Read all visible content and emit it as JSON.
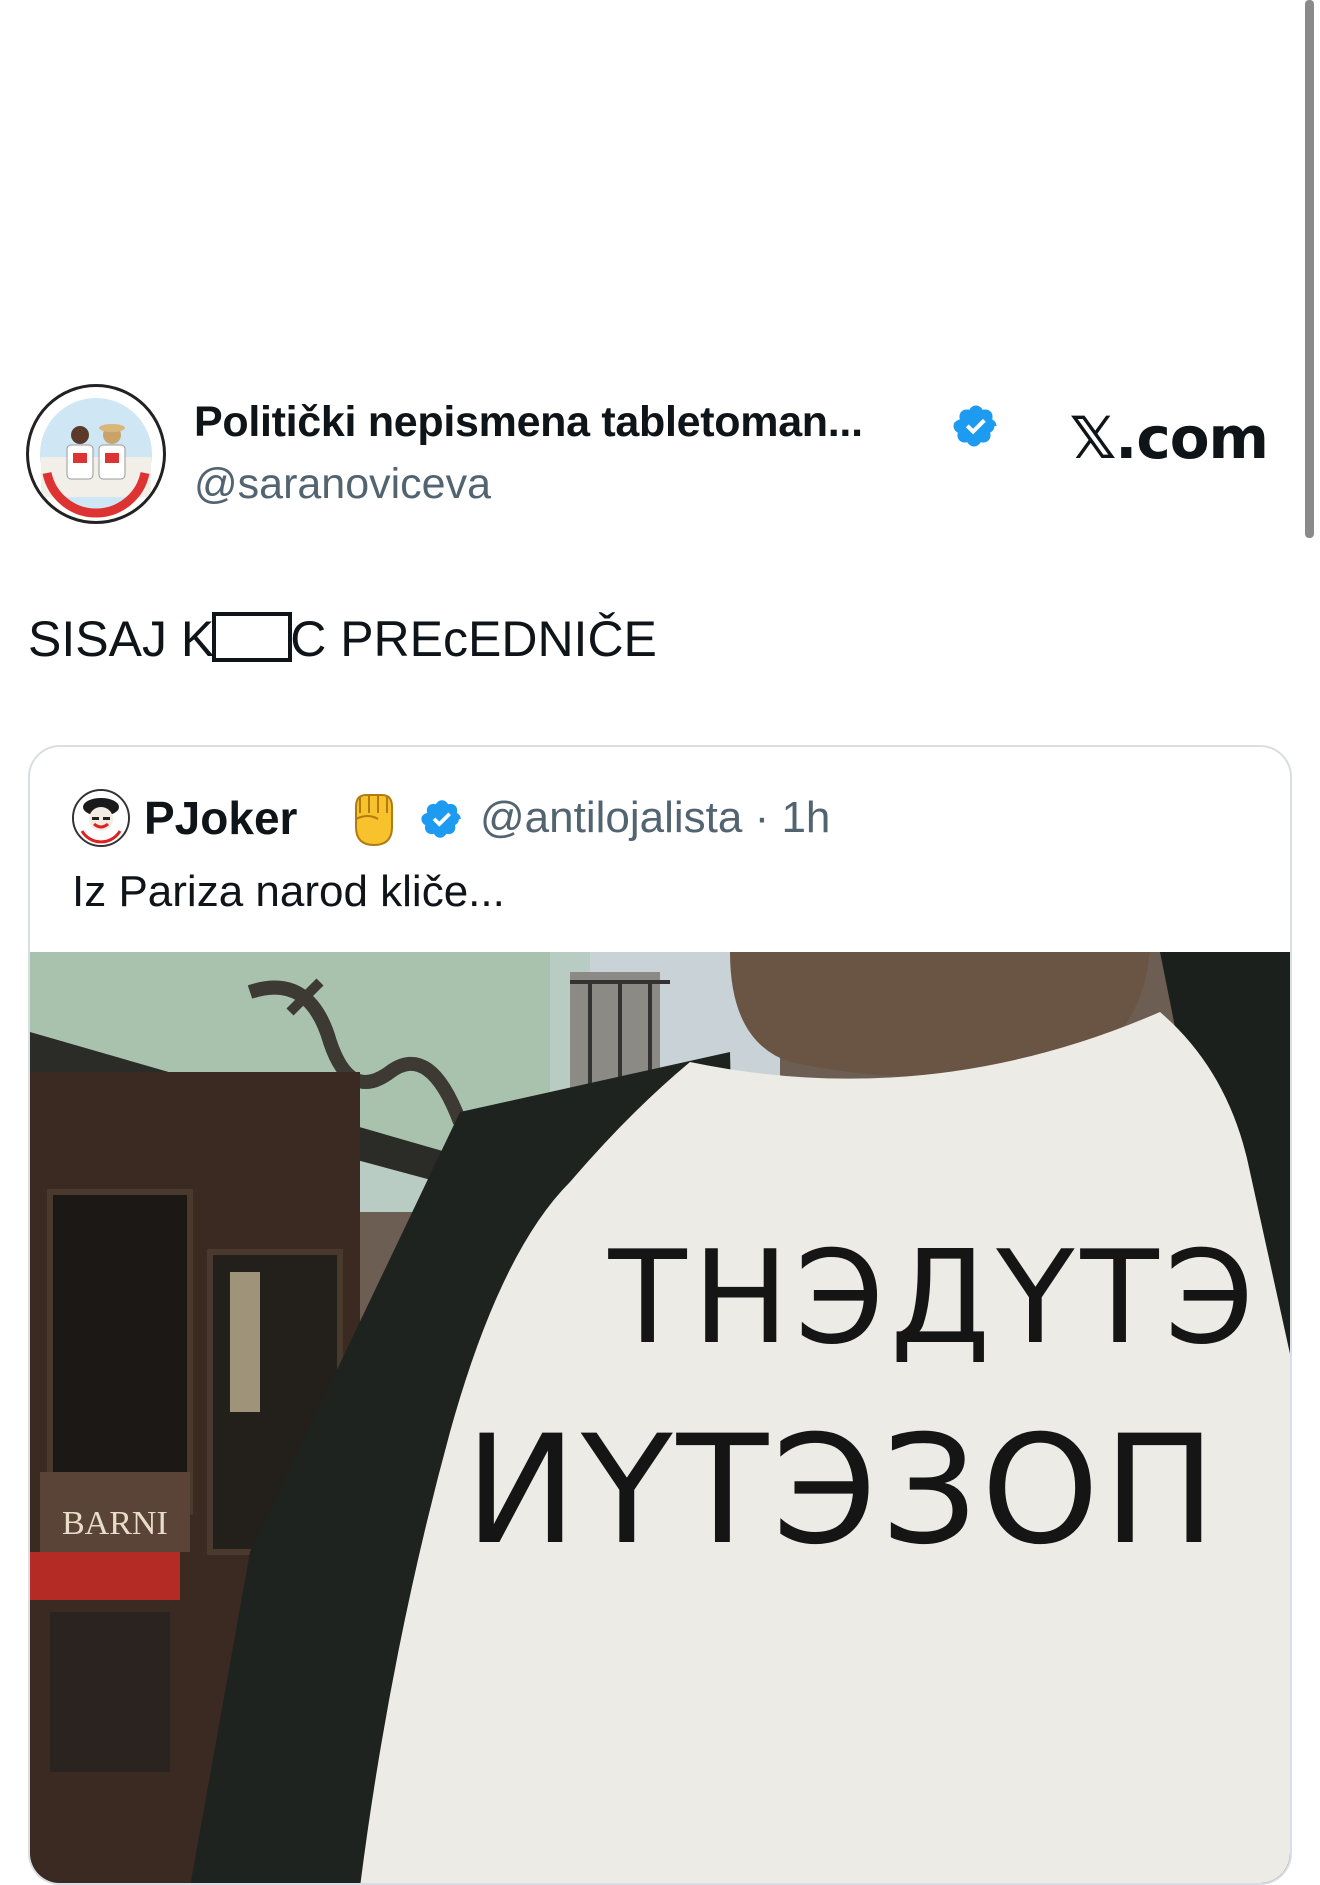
{
  "header": {
    "display_name": "Politički nepismena tabletoman...",
    "handle": "@saranoviceva",
    "site": "𝕏.com",
    "verified_icon": "verified-badge"
  },
  "tweet": {
    "text_before": "SISAJ K",
    "text_after": "C PREcEDNIČE"
  },
  "quote": {
    "name": "PJoker",
    "emoji": "raised-fist",
    "handle_time": "@antilojalista · 1h",
    "text": "Iz Pariza narod kliče..."
  },
  "photo": {
    "storefront_sign": "BARNI",
    "shirt_line1": "ТНЭДҮТЭ",
    "shirt_line2": "ИҮТЭЗОП"
  },
  "colors": {
    "verified": "#1d9bf0",
    "muted_text": "#536471",
    "border": "#d8dee4"
  }
}
